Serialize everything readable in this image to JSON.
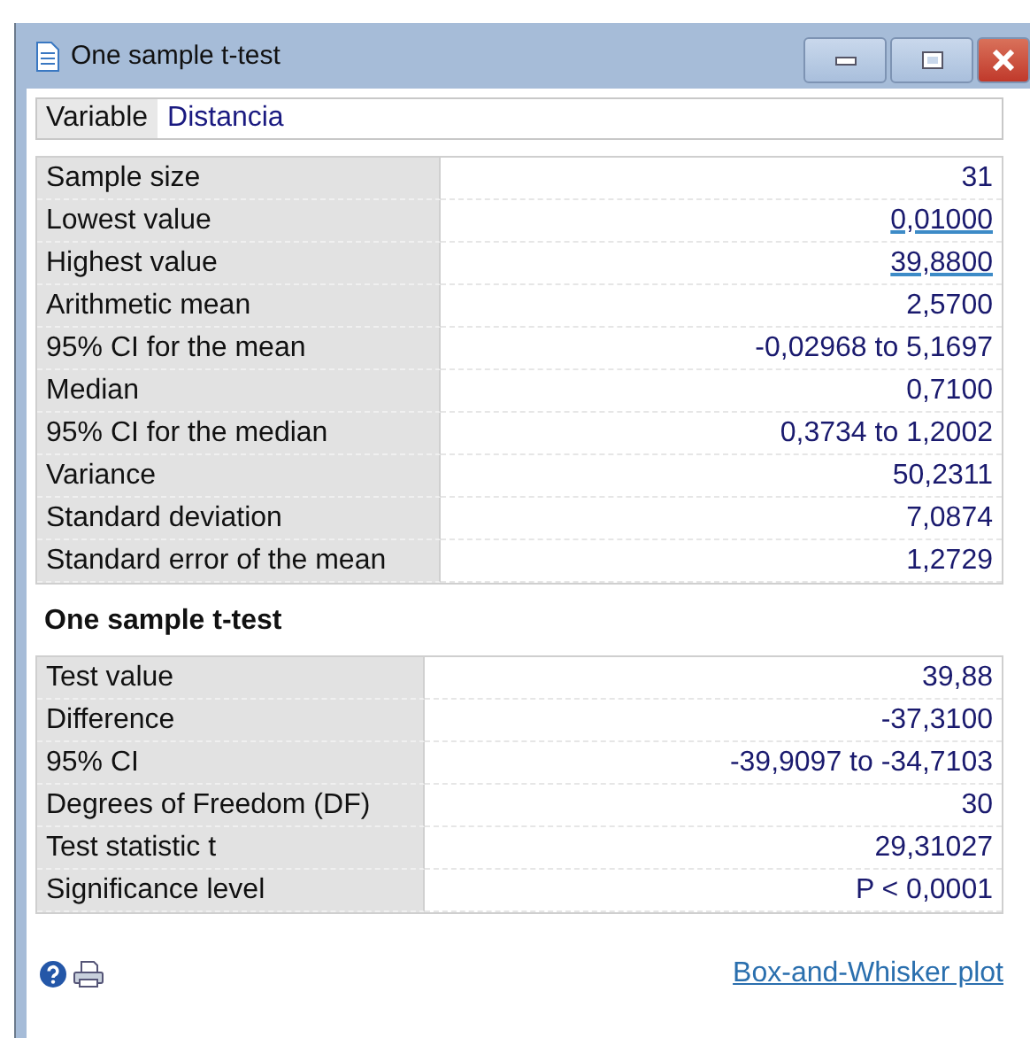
{
  "window": {
    "title": "One sample t-test"
  },
  "variable": {
    "label": "Variable",
    "value": "Distancia"
  },
  "summary": [
    {
      "label": "Sample size",
      "value": "31",
      "link": false
    },
    {
      "label": "Lowest value",
      "value": "0,01000",
      "link": true
    },
    {
      "label": "Highest value",
      "value": "39,8800",
      "link": true
    },
    {
      "label": "Arithmetic mean",
      "value": "2,5700",
      "link": false
    },
    {
      "label": "95% CI for the mean",
      "value": "-0,02968 to 5,1697",
      "link": false
    },
    {
      "label": "Median",
      "value": "0,7100",
      "link": false
    },
    {
      "label": "95% CI for the median",
      "value": "0,3734 to 1,2002",
      "link": false
    },
    {
      "label": "Variance",
      "value": "50,2311",
      "link": false
    },
    {
      "label": "Standard deviation",
      "value": "7,0874",
      "link": false
    },
    {
      "label": "Standard error of the mean",
      "value": "1,2729",
      "link": false
    }
  ],
  "test": {
    "title": "One sample t-test",
    "rows": [
      {
        "label": "Test value",
        "value": "39,88",
        "link": false
      },
      {
        "label": "Difference",
        "value": "-37,3100",
        "link": false
      },
      {
        "label": "95% CI",
        "value": "-39,9097 to -34,7103",
        "link": false
      },
      {
        "label": "Degrees of Freedom (DF)",
        "value": "30",
        "link": false
      },
      {
        "label": "Test statistic t",
        "value": "29,31027",
        "link": false
      },
      {
        "label": "Significance level",
        "value": "P < 0,0001",
        "link": false
      }
    ]
  },
  "footer": {
    "link": "Box-and-Whisker plot"
  }
}
